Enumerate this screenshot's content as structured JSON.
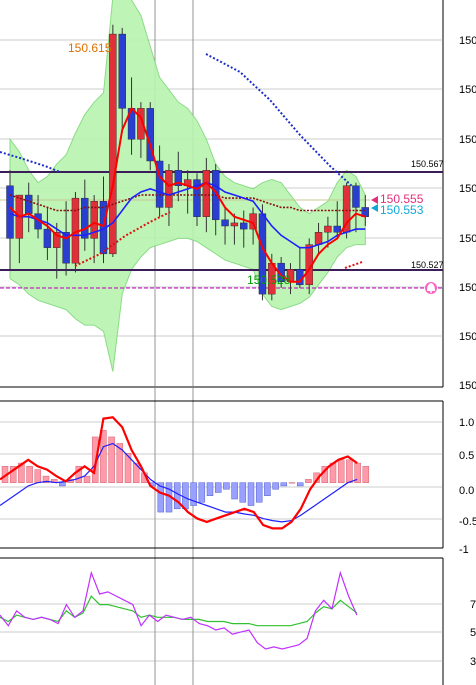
{
  "colors": {
    "panel_border": "#000000",
    "grid": "#808080",
    "bull": "#e0303a",
    "bear": "#2a3fd0",
    "band_fill": "#b8f5b0",
    "band_line": "#7fd87a",
    "ma_fast": "#ff0000",
    "ma_mid": "#2020ff",
    "ma_slow": "#8a1010",
    "dotted_blue": "#1c2fc8",
    "dotted_red": "#e01010",
    "hline": "#3b1d5a",
    "level_line": "#c000c0",
    "label_orange": "#e07000",
    "label_green": "#00a000",
    "label_pink": "#e0307a",
    "label_cyan": "#10a8d8",
    "macd_pos": "#ff9aa8",
    "macd_neg": "#9aa0ff",
    "rsi_purple": "#c030ff",
    "rsi_green": "#30c030"
  },
  "main": {
    "axis_ticks": [
      "150",
      "150",
      "150",
      "150",
      "150",
      "150",
      "150",
      "150"
    ],
    "label_high": "150.615",
    "label_low": "150.528",
    "label_upper_line": "150.567",
    "label_lower_line": "150.527",
    "label_bid": "150.555",
    "label_ask": "150.553",
    "alert_icon": "alarm-bell-icon"
  },
  "macd": {
    "axis_ticks": [
      "1.0",
      "0.5",
      "0.0",
      "-0.5",
      "-1"
    ]
  },
  "rsi": {
    "axis_ticks": [
      "7",
      "5",
      "3"
    ]
  },
  "chart_data": {
    "type": "candlestick",
    "candles": [
      {
        "o": 150.565,
        "h": 150.57,
        "l": 150.538,
        "c": 150.548
      },
      {
        "o": 150.548,
        "h": 150.56,
        "l": 150.54,
        "c": 150.562
      },
      {
        "o": 150.562,
        "h": 150.566,
        "l": 150.55,
        "c": 150.556
      },
      {
        "o": 150.556,
        "h": 150.562,
        "l": 150.548,
        "c": 150.551
      },
      {
        "o": 150.551,
        "h": 150.558,
        "l": 150.541,
        "c": 150.545
      },
      {
        "o": 150.545,
        "h": 150.553,
        "l": 150.535,
        "c": 150.55
      },
      {
        "o": 150.55,
        "h": 150.56,
        "l": 150.536,
        "c": 150.54
      },
      {
        "o": 150.54,
        "h": 150.563,
        "l": 150.537,
        "c": 150.561
      },
      {
        "o": 150.561,
        "h": 150.567,
        "l": 150.544,
        "c": 150.548
      },
      {
        "o": 150.548,
        "h": 150.562,
        "l": 150.54,
        "c": 150.56
      },
      {
        "o": 150.56,
        "h": 150.568,
        "l": 150.54,
        "c": 150.543
      },
      {
        "o": 150.543,
        "h": 150.617,
        "l": 150.542,
        "c": 150.614
      },
      {
        "o": 150.614,
        "h": 150.616,
        "l": 150.583,
        "c": 150.59
      },
      {
        "o": 150.59,
        "h": 150.6,
        "l": 150.575,
        "c": 150.58
      },
      {
        "o": 150.58,
        "h": 150.592,
        "l": 150.574,
        "c": 150.59
      },
      {
        "o": 150.59,
        "h": 150.592,
        "l": 150.57,
        "c": 150.573
      },
      {
        "o": 150.573,
        "h": 150.578,
        "l": 150.555,
        "c": 150.558
      },
      {
        "o": 150.558,
        "h": 150.572,
        "l": 150.552,
        "c": 150.57
      },
      {
        "o": 150.57,
        "h": 150.576,
        "l": 150.56,
        "c": 150.565
      },
      {
        "o": 150.565,
        "h": 150.57,
        "l": 150.556,
        "c": 150.567
      },
      {
        "o": 150.567,
        "h": 150.569,
        "l": 150.552,
        "c": 150.555
      },
      {
        "o": 150.555,
        "h": 150.574,
        "l": 150.55,
        "c": 150.57
      },
      {
        "o": 150.57,
        "h": 150.572,
        "l": 150.549,
        "c": 150.554
      },
      {
        "o": 150.554,
        "h": 150.558,
        "l": 150.546,
        "c": 150.552
      },
      {
        "o": 150.552,
        "h": 150.556,
        "l": 150.546,
        "c": 150.553
      },
      {
        "o": 150.553,
        "h": 150.557,
        "l": 150.545,
        "c": 150.551
      },
      {
        "o": 150.551,
        "h": 150.558,
        "l": 150.546,
        "c": 150.556
      },
      {
        "o": 150.556,
        "h": 150.559,
        "l": 150.528,
        "c": 150.53
      },
      {
        "o": 150.53,
        "h": 150.543,
        "l": 150.528,
        "c": 150.54
      },
      {
        "o": 150.54,
        "h": 150.542,
        "l": 150.532,
        "c": 150.534
      },
      {
        "o": 150.534,
        "h": 150.54,
        "l": 150.53,
        "c": 150.538
      },
      {
        "o": 150.538,
        "h": 150.545,
        "l": 150.532,
        "c": 150.533
      },
      {
        "o": 150.533,
        "h": 150.548,
        "l": 150.53,
        "c": 150.546
      },
      {
        "o": 150.546,
        "h": 150.553,
        "l": 150.543,
        "c": 150.55
      },
      {
        "o": 150.55,
        "h": 150.555,
        "l": 150.545,
        "c": 150.552
      },
      {
        "o": 150.552,
        "h": 150.56,
        "l": 150.548,
        "c": 150.55
      },
      {
        "o": 150.55,
        "h": 150.566,
        "l": 150.548,
        "c": 150.565
      },
      {
        "o": 150.565,
        "h": 150.566,
        "l": 150.55,
        "c": 150.558
      },
      {
        "o": 150.558,
        "h": 150.562,
        "l": 150.552,
        "c": 150.555
      }
    ],
    "bollinger_upper": [
      150.58,
      150.576,
      150.57,
      150.566,
      150.568,
      150.572,
      150.575,
      150.582,
      150.588,
      150.592,
      150.595,
      150.626,
      150.628,
      150.625,
      150.62,
      150.61,
      150.6,
      150.596,
      150.592,
      150.59,
      150.586,
      150.58,
      150.572,
      150.568,
      150.566,
      150.565,
      150.564,
      150.566,
      150.567,
      150.566,
      150.562,
      150.558,
      150.556,
      150.558,
      150.56,
      150.566,
      150.57,
      150.568,
      150.562
    ],
    "bollinger_lower": [
      150.535,
      150.533,
      150.53,
      150.528,
      150.527,
      150.526,
      150.525,
      150.522,
      150.52,
      150.52,
      150.518,
      150.505,
      150.53,
      150.538,
      150.542,
      150.545,
      150.546,
      150.547,
      150.548,
      150.548,
      150.547,
      150.545,
      150.543,
      150.541,
      150.54,
      150.539,
      150.538,
      150.53,
      150.526,
      150.525,
      150.526,
      150.527,
      150.529,
      150.533,
      150.537,
      150.542,
      150.545,
      150.546,
      150.546
    ],
    "ma_fast": [
      150.558,
      150.555,
      150.556,
      150.554,
      150.552,
      150.549,
      150.548,
      150.55,
      150.551,
      150.553,
      150.552,
      150.565,
      150.583,
      150.59,
      150.587,
      150.578,
      150.568,
      150.565,
      150.566,
      150.565,
      150.564,
      150.566,
      150.563,
      150.558,
      150.555,
      150.554,
      150.553,
      150.545,
      150.54,
      150.536,
      150.534,
      150.534,
      150.538,
      150.543,
      150.546,
      150.548,
      150.553,
      150.556,
      150.555
    ],
    "ma_mid": [
      150.556,
      150.555,
      150.555,
      150.554,
      150.553,
      150.551,
      150.549,
      150.549,
      150.549,
      150.55,
      150.551,
      150.553,
      150.557,
      150.561,
      150.563,
      150.564,
      150.563,
      150.562,
      150.563,
      150.564,
      150.565,
      150.566,
      150.565,
      150.563,
      150.562,
      150.561,
      150.56,
      150.556,
      150.552,
      150.549,
      150.547,
      150.545,
      150.545,
      150.546,
      150.547,
      150.549,
      150.55,
      150.551,
      150.551
    ],
    "ma_slow": [
      150.562,
      150.561,
      150.56,
      150.559,
      150.558,
      150.557,
      150.557,
      150.557,
      150.558,
      150.558,
      150.558,
      150.559,
      150.56,
      150.561,
      150.562,
      150.562,
      150.562,
      150.562,
      150.562,
      150.562,
      150.562,
      150.562,
      150.562,
      150.561,
      150.561,
      150.561,
      150.561,
      150.56,
      150.559,
      150.558,
      150.558,
      150.557,
      150.557,
      150.557,
      150.557,
      150.557,
      150.557,
      150.557,
      150.557
    ],
    "macd_hist": [
      0.25,
      0.25,
      0.3,
      0.25,
      0.2,
      0.1,
      0.05,
      -0.05,
      0.05,
      0.25,
      0.1,
      0.7,
      0.8,
      0.7,
      0.6,
      0.45,
      0.3,
      0.15,
      -0.05,
      -0.45,
      -0.45,
      -0.4,
      -0.4,
      -0.35,
      -0.3,
      -0.2,
      -0.15,
      -0.1,
      -0.25,
      -0.3,
      -0.35,
      -0.3,
      -0.2,
      -0.1,
      -0.05,
      0.0,
      -0.05,
      0.05,
      0.15,
      0.25,
      0.3,
      0.35,
      0.35,
      0.3,
      0.25
    ],
    "macd_signal": [
      0.05,
      0.15,
      0.25,
      0.35,
      0.25,
      0.2,
      0.1,
      0.02,
      0.15,
      0.25,
      0.15,
      0.98,
      1.0,
      0.85,
      0.5,
      0.25,
      -0.05,
      -0.15,
      -0.2,
      -0.3,
      -0.45,
      -0.55,
      -0.6,
      -0.55,
      -0.5,
      -0.45,
      -0.4,
      -0.45,
      -0.65,
      -0.7,
      -0.7,
      -0.6,
      -0.4,
      -0.1,
      0.1,
      0.25,
      0.35,
      0.4,
      0.3
    ],
    "macd_line": [
      -0.35,
      -0.25,
      -0.15,
      -0.05,
      0.0,
      0.02,
      0.0,
      0.02,
      0.05,
      0.1,
      0.25,
      0.55,
      0.6,
      0.5,
      0.35,
      0.2,
      0.05,
      -0.05,
      -0.1,
      -0.18,
      -0.25,
      -0.3,
      -0.35,
      -0.4,
      -0.45,
      -0.45,
      -0.48,
      -0.5,
      -0.55,
      -0.58,
      -0.6,
      -0.58,
      -0.5,
      -0.4,
      -0.3,
      -0.2,
      -0.1,
      0.0,
      0.05
    ],
    "rsi_purple": [
      53,
      48,
      55,
      52,
      51,
      52,
      51,
      49,
      58,
      52,
      55,
      73,
      63,
      64,
      62,
      60,
      58,
      48,
      53,
      50,
      53,
      52,
      51,
      52,
      49,
      48,
      46,
      47,
      44,
      45,
      46,
      40,
      37,
      38,
      37,
      38,
      39,
      42,
      55,
      60,
      56,
      73,
      62,
      53
    ],
    "rsi_green": [
      52,
      50,
      53,
      52,
      51,
      52,
      51,
      50,
      55,
      52,
      54,
      62,
      58,
      58,
      57,
      56,
      55,
      52,
      53,
      52,
      52,
      52,
      51,
      51,
      51,
      50,
      50,
      50,
      49,
      49,
      49,
      48,
      48,
      48,
      48,
      48,
      49,
      50,
      54,
      57,
      56,
      60,
      57,
      54
    ]
  }
}
